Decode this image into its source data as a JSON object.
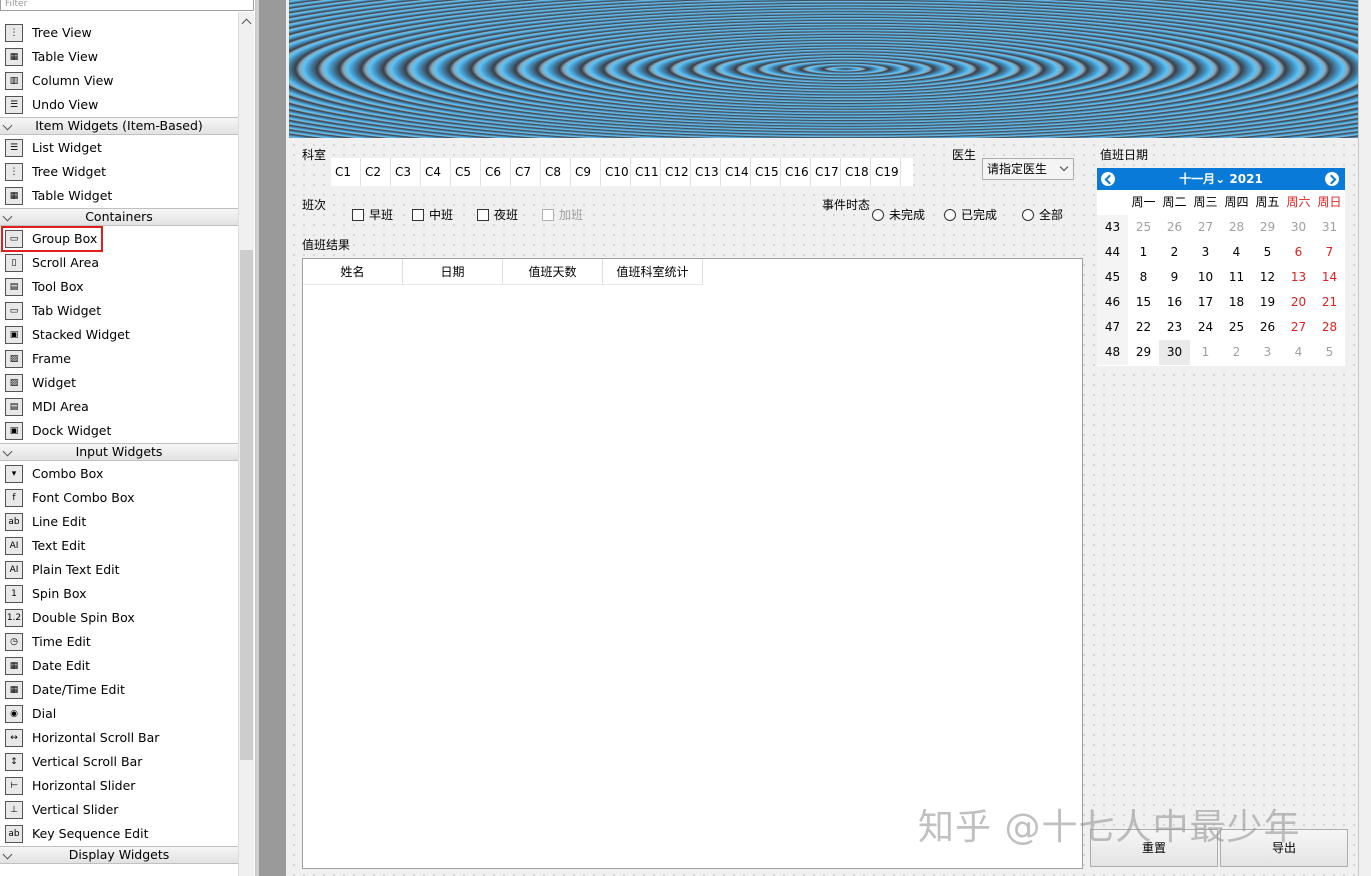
{
  "widget_box": {
    "filter_placeholder": "Filter",
    "categories": {
      "item_widgets": "Item Widgets (Item-Based)",
      "containers": "Containers",
      "input_widgets": "Input Widgets",
      "display_widgets": "Display Widgets"
    },
    "items": [
      {
        "label": "Tree View",
        "icon": "tree-view-icon"
      },
      {
        "label": "Table View",
        "icon": "table-view-icon"
      },
      {
        "label": "Column View",
        "icon": "column-view-icon"
      },
      {
        "label": "Undo View",
        "icon": "undo-view-icon"
      },
      {
        "label": "List Widget",
        "icon": "list-widget-icon"
      },
      {
        "label": "Tree Widget",
        "icon": "tree-widget-icon"
      },
      {
        "label": "Table Widget",
        "icon": "table-widget-icon"
      },
      {
        "label": "Group Box",
        "icon": "group-box-icon"
      },
      {
        "label": "Scroll Area",
        "icon": "scroll-area-icon"
      },
      {
        "label": "Tool Box",
        "icon": "tool-box-icon"
      },
      {
        "label": "Tab Widget",
        "icon": "tab-widget-icon"
      },
      {
        "label": "Stacked Widget",
        "icon": "stacked-widget-icon"
      },
      {
        "label": "Frame",
        "icon": "frame-icon"
      },
      {
        "label": "Widget",
        "icon": "widget-icon"
      },
      {
        "label": "MDI Area",
        "icon": "mdi-area-icon"
      },
      {
        "label": "Dock Widget",
        "icon": "dock-widget-icon"
      },
      {
        "label": "Combo Box",
        "icon": "combo-box-icon"
      },
      {
        "label": "Font Combo Box",
        "icon": "font-combo-box-icon"
      },
      {
        "label": "Line Edit",
        "icon": "line-edit-icon"
      },
      {
        "label": "Text Edit",
        "icon": "text-edit-icon"
      },
      {
        "label": "Plain Text Edit",
        "icon": "plain-text-edit-icon"
      },
      {
        "label": "Spin Box",
        "icon": "spin-box-icon"
      },
      {
        "label": "Double Spin Box",
        "icon": "double-spin-box-icon"
      },
      {
        "label": "Time Edit",
        "icon": "time-edit-icon"
      },
      {
        "label": "Date Edit",
        "icon": "date-edit-icon"
      },
      {
        "label": "Date/Time Edit",
        "icon": "date-time-edit-icon"
      },
      {
        "label": "Dial",
        "icon": "dial-icon"
      },
      {
        "label": "Horizontal Scroll Bar",
        "icon": "horizontal-scroll-bar-icon"
      },
      {
        "label": "Vertical Scroll Bar",
        "icon": "vertical-scroll-bar-icon"
      },
      {
        "label": "Horizontal Slider",
        "icon": "horizontal-slider-icon"
      },
      {
        "label": "Vertical Slider",
        "icon": "vertical-slider-icon"
      },
      {
        "label": "Key Sequence Edit",
        "icon": "key-sequence-edit-icon"
      }
    ]
  },
  "form": {
    "department": {
      "title": "科室",
      "items": [
        "C1",
        "C2",
        "C3",
        "C4",
        "C5",
        "C6",
        "C7",
        "C8",
        "C9",
        "C10",
        "C11",
        "C12",
        "C13",
        "C14",
        "C15",
        "C16",
        "C17",
        "C18",
        "C19"
      ]
    },
    "doctor": {
      "title": "医生",
      "selected": "请指定医生"
    },
    "shift": {
      "title": "班次",
      "options": [
        {
          "label": "早班",
          "checked": false,
          "enabled": true
        },
        {
          "label": "中班",
          "checked": false,
          "enabled": true
        },
        {
          "label": "夜班",
          "checked": false,
          "enabled": true
        },
        {
          "label": "加班",
          "checked": false,
          "enabled": false
        }
      ]
    },
    "event_state": {
      "title": "事件时态",
      "options": [
        {
          "label": "未完成",
          "selected": false
        },
        {
          "label": "已完成",
          "selected": false
        },
        {
          "label": "全部",
          "selected": false
        }
      ]
    },
    "result": {
      "title": "值班结果",
      "columns": [
        "姓名",
        "日期",
        "值班天数",
        "值班科室统计"
      ]
    },
    "duty_date": {
      "title": "值班日期",
      "calendar": {
        "month": "十一月",
        "year": "2021",
        "weekdays": [
          "周一",
          "周二",
          "周三",
          "周四",
          "周五",
          "周六",
          "周日"
        ],
        "weeks": [
          {
            "num": "43",
            "days": [
              "25",
              "26",
              "27",
              "28",
              "29",
              "30",
              "31"
            ]
          },
          {
            "num": "44",
            "days": [
              "1",
              "2",
              "3",
              "4",
              "5",
              "6",
              "7"
            ]
          },
          {
            "num": "45",
            "days": [
              "8",
              "9",
              "10",
              "11",
              "12",
              "13",
              "14"
            ]
          },
          {
            "num": "46",
            "days": [
              "15",
              "16",
              "17",
              "18",
              "19",
              "20",
              "21"
            ]
          },
          {
            "num": "47",
            "days": [
              "22",
              "23",
              "24",
              "25",
              "26",
              "27",
              "28"
            ]
          },
          {
            "num": "48",
            "days": [
              "29",
              "30",
              "1",
              "2",
              "3",
              "4",
              "5"
            ]
          }
        ],
        "selected_day": "30"
      }
    },
    "buttons": {
      "reset": "重置",
      "export": "导出"
    }
  },
  "watermark": "知乎 @十七人中最少年",
  "colors": {
    "accent": "#0a7ad8",
    "weekend": "#e02020",
    "highlight": "#e02020"
  }
}
